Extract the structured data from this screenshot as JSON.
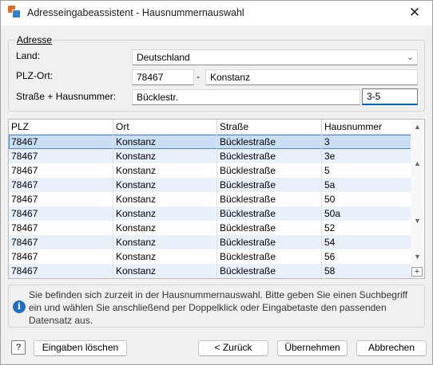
{
  "window": {
    "title": "Adresseingabeassistent - Hausnummernauswahl",
    "close_glyph": "✕"
  },
  "address": {
    "group_label": "Adresse",
    "land_label": "Land:",
    "land_value": "Deutschland",
    "plz_ort_label": "PLZ-Ort:",
    "plz_value": "78467",
    "separator": "-",
    "ort_value": "Konstanz",
    "strasse_label": "Straße + Hausnummer:",
    "strasse_value": "Bücklestr.",
    "hausnummer_value": "3-5"
  },
  "table": {
    "columns": [
      "PLZ",
      "Ort",
      "Straße",
      "Hausnummer"
    ],
    "rows": [
      [
        "78467",
        "Konstanz",
        "Bücklestraße",
        "3"
      ],
      [
        "78467",
        "Konstanz",
        "Bücklestraße",
        "3e"
      ],
      [
        "78467",
        "Konstanz",
        "Bücklestraße",
        "5"
      ],
      [
        "78467",
        "Konstanz",
        "Bücklestraße",
        "5a"
      ],
      [
        "78467",
        "Konstanz",
        "Bücklestraße",
        "50"
      ],
      [
        "78467",
        "Konstanz",
        "Bücklestraße",
        "50a"
      ],
      [
        "78467",
        "Konstanz",
        "Bücklestraße",
        "52"
      ],
      [
        "78467",
        "Konstanz",
        "Bücklestraße",
        "54"
      ],
      [
        "78467",
        "Konstanz",
        "Bücklestraße",
        "56"
      ],
      [
        "78467",
        "Konstanz",
        "Bücklestraße",
        "58"
      ]
    ],
    "selected_row": 0
  },
  "info": {
    "text": "Sie befinden sich zurzeit in der Hausnummernauswahl. Bitte geben Sie einen Suchbegriff ein und wählen Sie anschließend per Doppelklick oder Eingabetaste den passenden Datensatz aus."
  },
  "buttons": {
    "help": "?",
    "clear": "Eingaben löschen",
    "back": "< Zurück",
    "accept": "Übernehmen",
    "cancel": "Abbrechen"
  },
  "colors": {
    "selection": "#c9def5",
    "alt_row": "#e8f0fa",
    "info_icon": "#1f6fc5"
  }
}
